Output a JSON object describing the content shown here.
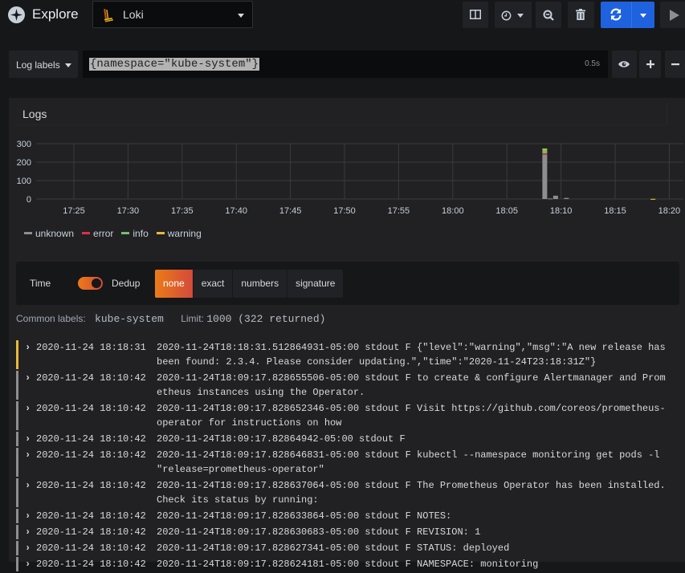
{
  "header": {
    "title": "Explore",
    "datasource": "Loki",
    "buttons": [
      "split-view",
      "time-picker",
      "zoom-out",
      "clear-all",
      "refresh",
      "refresh-interval",
      "run-query"
    ]
  },
  "query": {
    "log_labels_button": "Log labels",
    "expression": "{namespace=\"kube-system\"}",
    "duration": "0.5s"
  },
  "panel": {
    "title": "Logs"
  },
  "chart_data": {
    "type": "bar",
    "stacked": true,
    "ylim": [
      0,
      300
    ],
    "yticks": [
      "0",
      "100",
      "200",
      "300"
    ],
    "xticks": [
      "17:25",
      "17:30",
      "17:35",
      "17:40",
      "17:45",
      "17:50",
      "17:55",
      "18:00",
      "18:05",
      "18:10",
      "18:15",
      "18:20"
    ],
    "grid": true,
    "legend_position": "bottom-left",
    "series": [
      {
        "name": "unknown",
        "color": "#8e8e8e",
        "points": [
          {
            "x": "18:08:30",
            "y": 240
          },
          {
            "x": "18:09:00",
            "y": 3
          },
          {
            "x": "18:09:30",
            "y": 18
          },
          {
            "x": "18:10:30",
            "y": 6
          },
          {
            "x": "18:18:30",
            "y": 0
          }
        ]
      },
      {
        "name": "error",
        "color": "#e02f44",
        "points": [
          {
            "x": "18:08:30",
            "y": 8
          }
        ]
      },
      {
        "name": "info",
        "color": "#73bf69",
        "points": [
          {
            "x": "18:08:30",
            "y": 22
          }
        ]
      },
      {
        "name": "warning",
        "color": "#fade2a",
        "points": [
          {
            "x": "18:08:30",
            "y": 3
          },
          {
            "x": "18:18:30",
            "y": 1
          }
        ]
      }
    ]
  },
  "legend": [
    {
      "label": "unknown",
      "color": "#8e8e8e"
    },
    {
      "label": "error",
      "color": "#e02f44"
    },
    {
      "label": "info",
      "color": "#73bf69"
    },
    {
      "label": "warning",
      "color": "#eab839"
    }
  ],
  "options": {
    "time_label": "Time",
    "time_enabled": true,
    "dedup_label": "Dedup",
    "dedup_options": [
      "none",
      "exact",
      "numbers",
      "signature"
    ],
    "dedup_selected": "none"
  },
  "meta": {
    "common_labels_label": "Common labels:",
    "common_labels_value": "kube-system",
    "limit_label": "Limit:",
    "limit_value": "1000 (322 returned)"
  },
  "logs": [
    {
      "level_color": "#eab839",
      "ts": "2020-11-24 18:18:31",
      "line": "2020-11-24T18:18:31.512864931-05:00 stdout F {\"level\":\"warning\",\"msg\":\"A new release has been found: 2.3.4. Please consider updating.\",\"time\":\"2020-11-24T23:18:31Z\"}"
    },
    {
      "level_color": "#8e8e8e",
      "ts": "2020-11-24 18:10:42",
      "line": "2020-11-24T18:09:17.828655506-05:00 stdout F to create & configure Alertmanager and Prometheus instances using the Operator."
    },
    {
      "level_color": "#8e8e8e",
      "ts": "2020-11-24 18:10:42",
      "line": "2020-11-24T18:09:17.828652346-05:00 stdout F Visit https://github.com/coreos/prometheus-operator for instructions on how"
    },
    {
      "level_color": "#8e8e8e",
      "ts": "2020-11-24 18:10:42",
      "line": "2020-11-24T18:09:17.82864942-05:00 stdout F"
    },
    {
      "level_color": "#8e8e8e",
      "ts": "2020-11-24 18:10:42",
      "line": "2020-11-24T18:09:17.828646831-05:00 stdout F kubectl --namespace monitoring get pods -l \"release=prometheus-operator\""
    },
    {
      "level_color": "#8e8e8e",
      "ts": "2020-11-24 18:10:42",
      "line": "2020-11-24T18:09:17.828637064-05:00 stdout F The Prometheus Operator has been installed. Check its status by running:"
    },
    {
      "level_color": "#8e8e8e",
      "ts": "2020-11-24 18:10:42",
      "line": "2020-11-24T18:09:17.828633864-05:00 stdout F NOTES:"
    },
    {
      "level_color": "#8e8e8e",
      "ts": "2020-11-24 18:10:42",
      "line": "2020-11-24T18:09:17.828630683-05:00 stdout F REVISION: 1"
    },
    {
      "level_color": "#8e8e8e",
      "ts": "2020-11-24 18:10:42",
      "line": "2020-11-24T18:09:17.828627341-05:00 stdout F STATUS: deployed"
    },
    {
      "level_color": "#8e8e8e",
      "ts": "2020-11-24 18:10:42",
      "line": "2020-11-24T18:09:17.828624181-05:00 stdout F NAMESPACE: monitoring"
    }
  ]
}
